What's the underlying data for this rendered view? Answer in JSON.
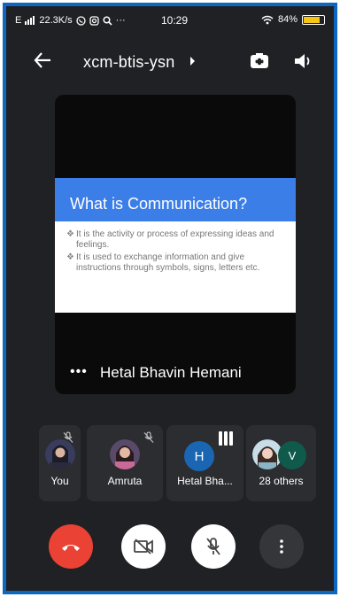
{
  "status_bar": {
    "network": "E",
    "speed": "22.3K/s",
    "overflow": "···",
    "time": "10:29",
    "battery": "84%",
    "battery_level": 0.84
  },
  "header": {
    "meeting_code": "xcm-btis-ysn"
  },
  "main_tile": {
    "slide_title": "What is Communication?",
    "slide_bullets": [
      "It is the activity or process of expressing ideas and feelings.",
      "It is used to exchange information and give instructions through symbols, signs, letters etc."
    ],
    "bullet_glyph": "❖",
    "more_glyph": "•••",
    "presenter_name": "Hetal Bhavin Hemani"
  },
  "participants": [
    {
      "label": "You"
    },
    {
      "label": "Amruta"
    },
    {
      "label": "Hetal Bha...",
      "initial": "H"
    },
    {
      "label": "28 others",
      "initial": "V"
    }
  ],
  "colors": {
    "background": "#202124",
    "frame": "#0b67c2",
    "slide_band": "#3c7ee8",
    "end_call": "#ea4335",
    "avatar_h": "#1a66b3",
    "avatar_v": "#0f5a4b"
  }
}
